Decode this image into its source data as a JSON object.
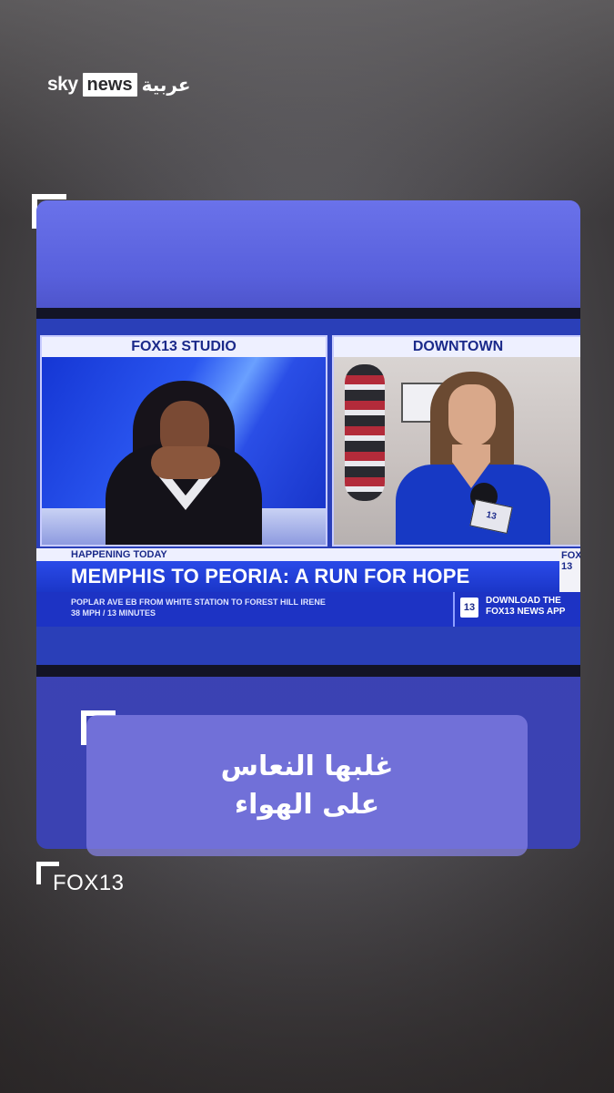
{
  "brand": {
    "logo_sky": "sky",
    "logo_news": "news",
    "logo_arabic": "عربية"
  },
  "broadcast": {
    "left_feed_label": "FOX13 STUDIO",
    "right_feed_label": "DOWNTOWN",
    "kicker": "HAPPENING TODAY",
    "headline": "MEMPHIS TO PEORIA: A RUN FOR HOPE",
    "ticker_line1": "POPLAR AVE EB FROM WHITE STATION TO FOREST HILL IRENE",
    "ticker_line2": "38 MPH / 13 MINUTES",
    "app_badge": "13",
    "app_line1": "DOWNLOAD THE",
    "app_line2": "FOX13 NEWS APP",
    "corner_bug": "FOX 13",
    "mic_flag": "13"
  },
  "caption": {
    "line1": "غلبها النعاس",
    "line2": "على الهواء"
  },
  "credit": "FOX13"
}
